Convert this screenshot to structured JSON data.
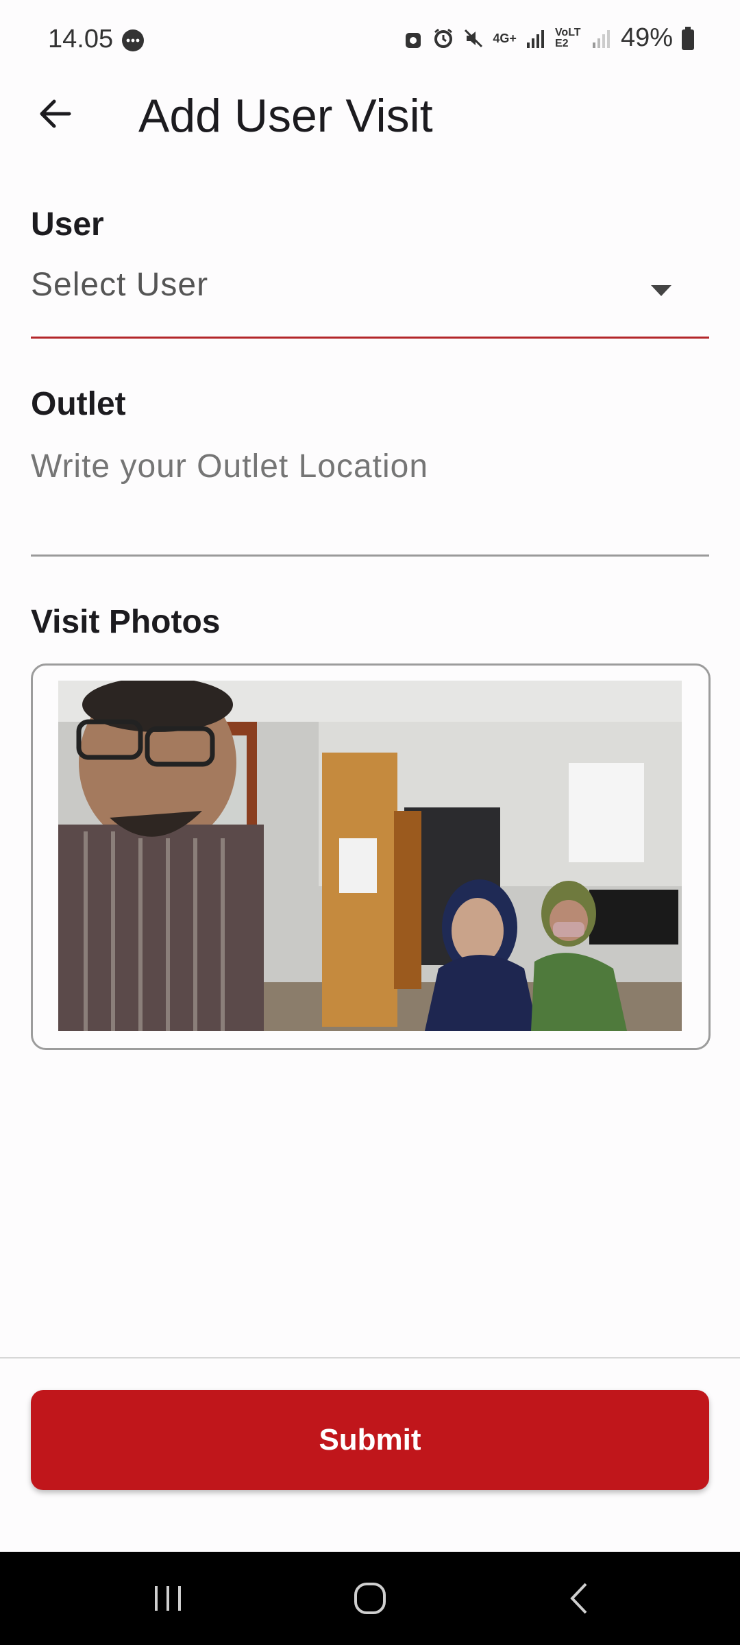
{
  "status_bar": {
    "time": "14.05",
    "battery_percent": "49%",
    "network_label": "4G+",
    "lte_label": "VoLTE2"
  },
  "app_bar": {
    "title": "Add User Visit",
    "back_icon": "arrow-left-icon"
  },
  "form": {
    "user": {
      "label": "User",
      "value": "Select User",
      "icon": "dropdown-arrow-icon"
    },
    "outlet": {
      "label": "Outlet",
      "placeholder": "Write your Outlet Location",
      "value": ""
    },
    "visit_photos": {
      "label": "Visit Photos"
    }
  },
  "footer": {
    "submit_label": "Submit"
  },
  "colors": {
    "accent": "#c0161b",
    "background": "#fdfcfd"
  },
  "nav": {
    "recents_icon": "recent-apps-icon",
    "home_icon": "home-icon",
    "back_icon": "nav-back-icon"
  }
}
